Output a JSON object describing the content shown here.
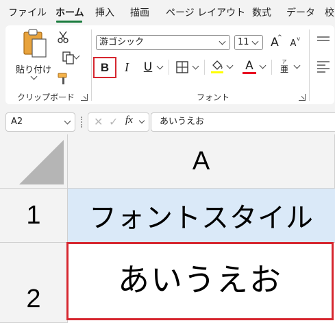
{
  "menu": {
    "tabs": [
      {
        "label": "ファイル",
        "active": false
      },
      {
        "label": "ホーム",
        "active": true
      },
      {
        "label": "挿入",
        "active": false
      },
      {
        "label": "描画",
        "active": false
      },
      {
        "label": "ページ レイアウト",
        "active": false
      },
      {
        "label": "数式",
        "active": false
      },
      {
        "label": "データ",
        "active": false
      },
      {
        "label": "校",
        "active": false
      }
    ]
  },
  "clipboard": {
    "paste_label": "貼り付け",
    "group_label": "クリップボード"
  },
  "font": {
    "font_name": "游ゴシック",
    "font_size": "11",
    "grow_glyph": "A",
    "shrink_glyph": "A",
    "bold_glyph": "B",
    "italic_glyph": "I",
    "underline_glyph": "U",
    "font_color_glyph": "A",
    "phonetic_top": "ア",
    "phonetic_bottom": "亜",
    "group_label": "フォント",
    "highlight_color": "#ffff00",
    "font_color": "#e81123"
  },
  "formula_bar": {
    "name_box": "A2",
    "fx_label": "fx",
    "content": "あいうえお"
  },
  "sheet": {
    "column_header": "A",
    "rows": [
      {
        "row_label": "1",
        "value": "フォントスタイル",
        "fill": "#dae9f8"
      },
      {
        "row_label": "2",
        "value": "あいうえお",
        "fill": "#ffffff"
      }
    ]
  },
  "highlight_color": "#d6262f"
}
